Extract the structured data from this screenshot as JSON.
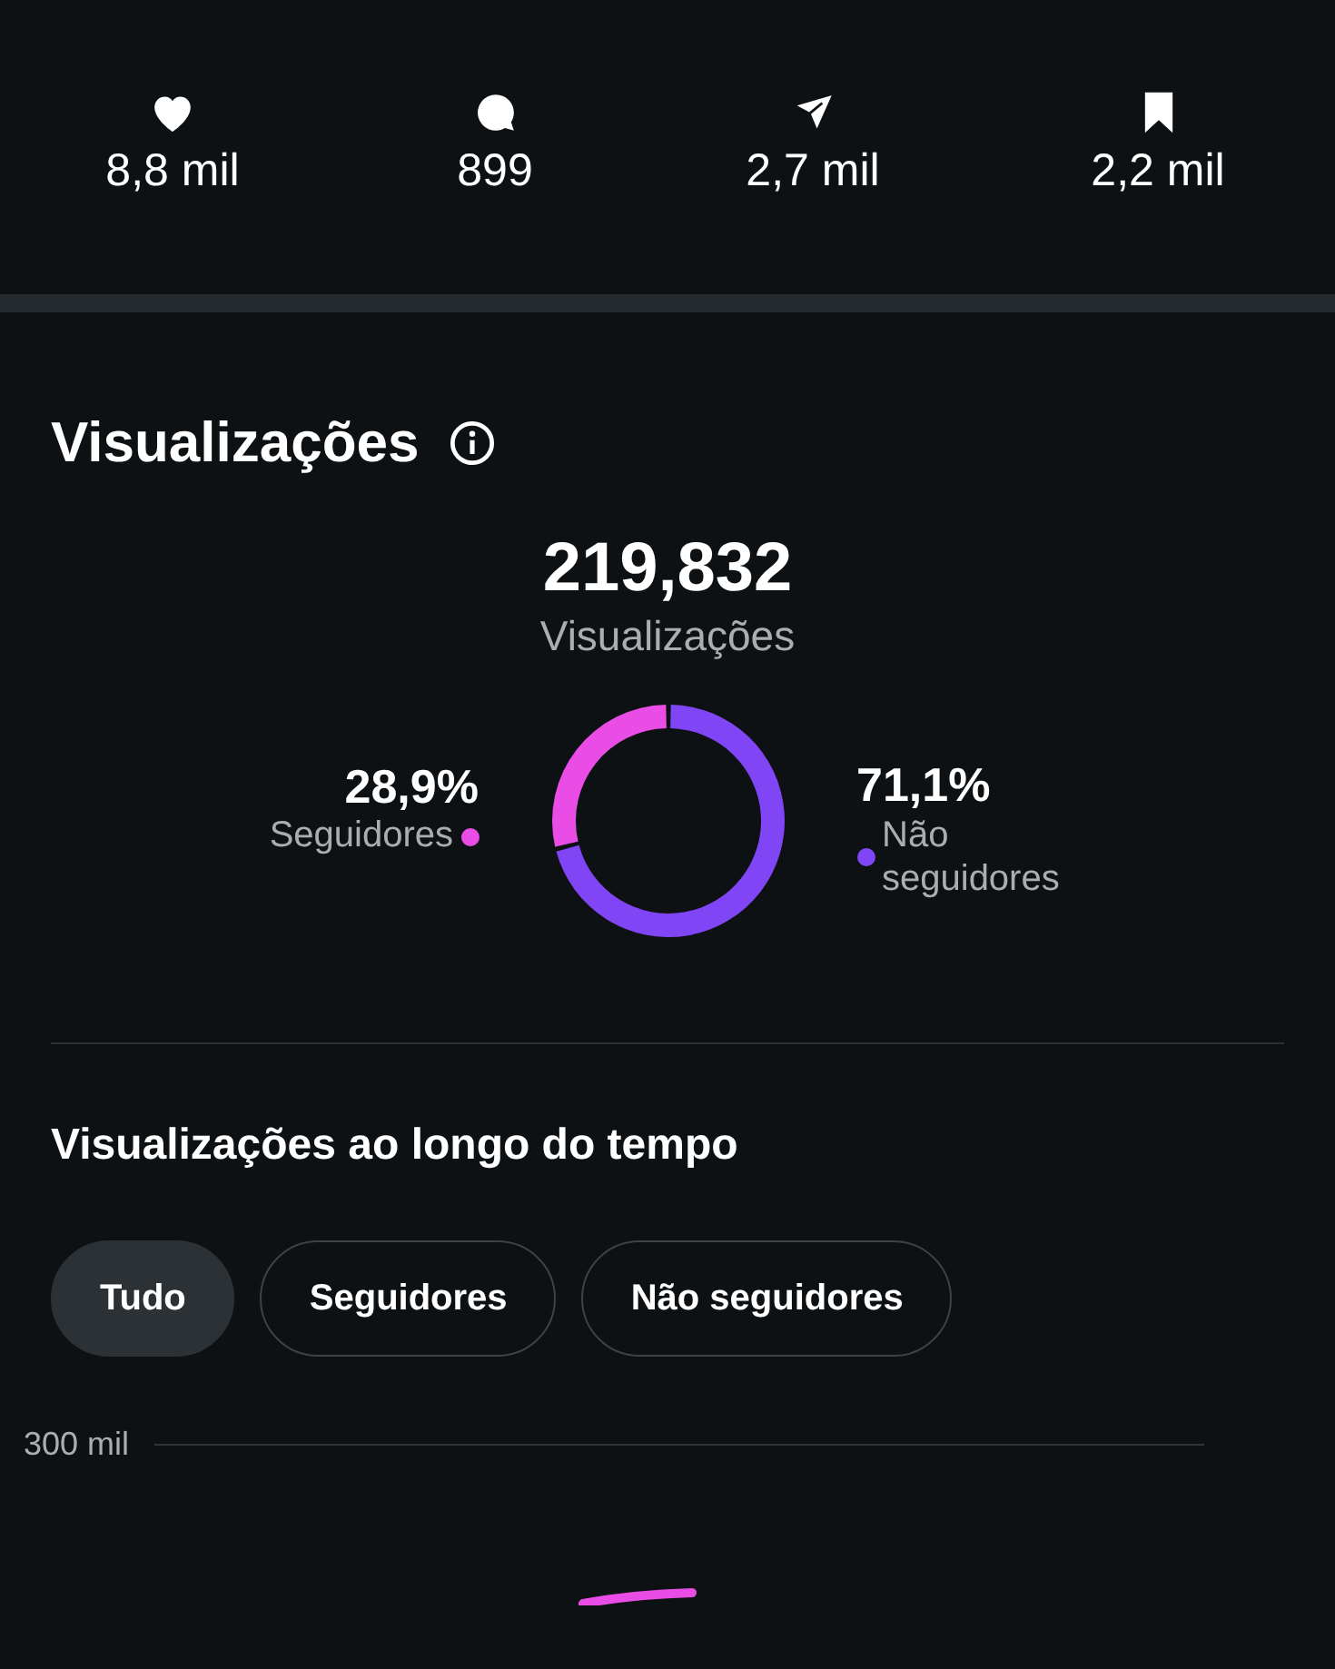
{
  "stats": [
    {
      "kind": "heart",
      "value": "8,8 mil"
    },
    {
      "kind": "comment",
      "value": "899"
    },
    {
      "kind": "send",
      "value": "2,7 mil"
    },
    {
      "kind": "bookmark",
      "value": "2,2 mil"
    }
  ],
  "views": {
    "title": "Visualizações",
    "total": "219,832",
    "total_label": "Visualizações",
    "legend": [
      {
        "percent": "28,9%",
        "color": "#e94de6"
      },
      {
        "percent": "71,1%",
        "color": "#8046f5"
      }
    ],
    "chart_data": {
      "type": "donut",
      "categories": [
        "Seguidores",
        "Não seguidores"
      ],
      "values": [
        28.9,
        71.1
      ]
    }
  },
  "timeline": {
    "title": "Visualizações ao longo do tempo",
    "filters": [
      {
        "label": "Tudo",
        "selected": true
      },
      {
        "label": "Seguidores",
        "selected": false
      },
      {
        "label": "Não seguidores",
        "selected": false
      }
    ],
    "axis_label": "300 mil"
  }
}
